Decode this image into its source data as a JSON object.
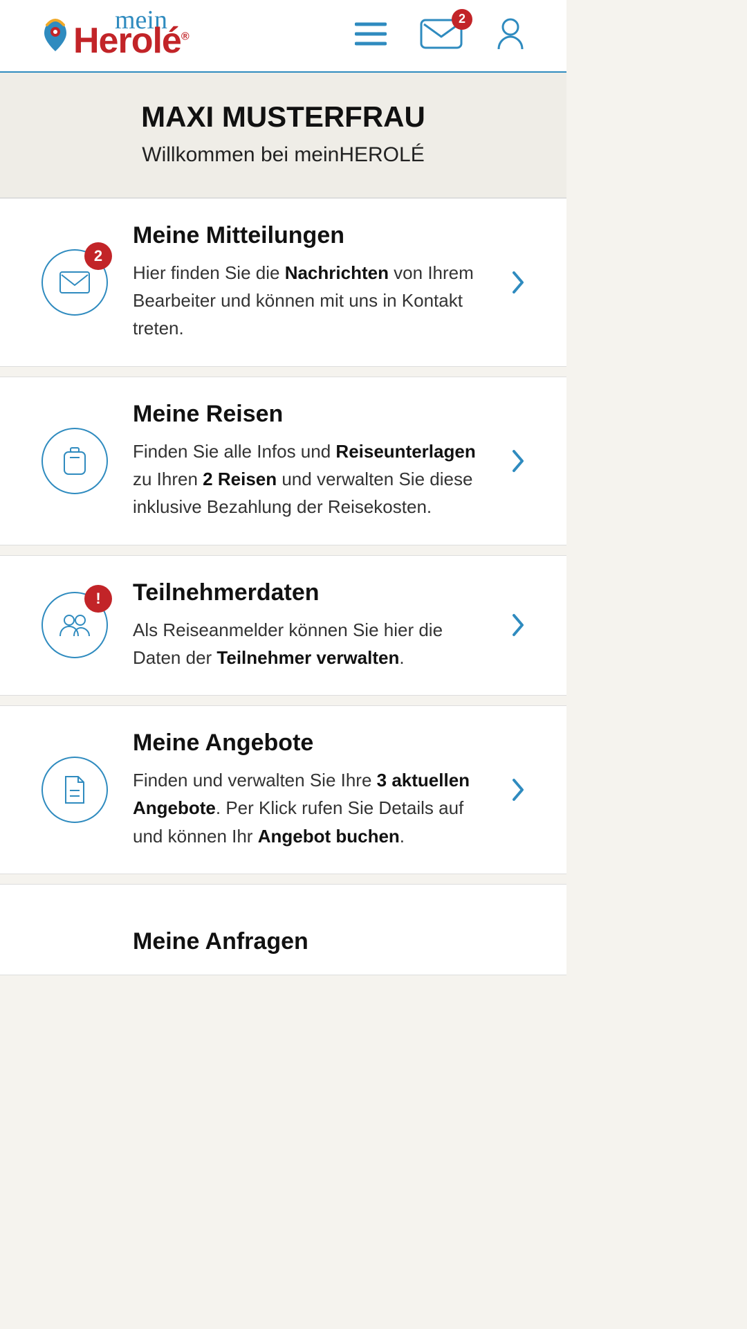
{
  "header": {
    "logo_mein": "mein",
    "logo_brand": "Herolé",
    "inbox_badge": "2"
  },
  "welcome": {
    "name": "MAXI MUSTERFRAU",
    "subtitle": "Willkommen bei meinHEROLÉ"
  },
  "cards": {
    "mitteilungen": {
      "title": "Meine Mitteilungen",
      "badge": "2",
      "desc_pre": "Hier finden Sie die ",
      "desc_b1": "Nachrichten",
      "desc_post": " von Ihrem Bearbeiter und können mit uns in Kontakt treten."
    },
    "reisen": {
      "title": "Meine Reisen",
      "desc_pre": "Finden Sie alle Infos und ",
      "desc_b1": "Reiseunterlagen",
      "desc_mid": " zu Ihren ",
      "desc_b2": "2 Reisen",
      "desc_post": " und verwalten Sie diese inklusive Bezahlung der Reisekosten."
    },
    "teilnehmer": {
      "title": "Teilnehmerdaten",
      "badge": "!",
      "desc_pre": "Als Reiseanmelder können Sie hier die Daten der ",
      "desc_b1": "Teilnehmer verwalten",
      "desc_post": "."
    },
    "angebote": {
      "title": "Meine Angebote",
      "desc_pre": "Finden und verwalten Sie Ihre ",
      "desc_b1": "3 aktuellen Angebote",
      "desc_mid": ". Per Klick rufen Sie Details auf und können Ihr ",
      "desc_b2": "Angebot buchen",
      "desc_post": "."
    },
    "anfragen": {
      "title": "Meine Anfragen"
    }
  }
}
